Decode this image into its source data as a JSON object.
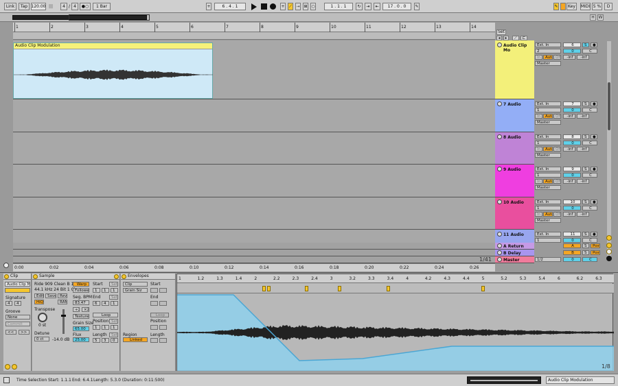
{
  "transport": {
    "link": "Link",
    "tap": "Tap",
    "tempo": "120.00",
    "sig_num": "4",
    "sig_den": "4",
    "metronome": "●○",
    "quantize": "1 Bar",
    "arrangement_pos": "6 . 4 . 1",
    "loop_start": "1 . 1 . 1",
    "loop_length": "17 . 0 . 0",
    "key": "Key",
    "midi": "MIDI",
    "cpu": "5 %",
    "d_label": "D",
    "h_label": "H",
    "w_label": "W"
  },
  "ruler": {
    "bars": [
      "1",
      "2",
      "3",
      "4",
      "5",
      "6",
      "7",
      "8",
      "9",
      "10",
      "11",
      "12",
      "13",
      "14"
    ],
    "set_label": "Set"
  },
  "time_ruler": [
    "0:00",
    "0:02",
    "0:04",
    "0:06",
    "0:08",
    "0:10",
    "0:12",
    "0:14",
    "0:16",
    "0:18",
    "0:20",
    "0:22",
    "0:24",
    "0:26"
  ],
  "page_indicator": "1/41",
  "clip": {
    "name": "Audio Clip Modulation"
  },
  "tracks": [
    {
      "name": "Audio Clip Mo",
      "color": "#f3f07a",
      "num": "6",
      "vol": "0",
      "send": "-inf",
      "send2": "-inf",
      "input": "Ext. In",
      "ch": "2",
      "out": "Master"
    },
    {
      "name": "7 Audio",
      "color": "#93aef6",
      "num": "7",
      "vol": "0",
      "send": "-inf",
      "send2": "-inf",
      "input": "Ext. In",
      "ch": "1",
      "out": "Master"
    },
    {
      "name": "8 Audio",
      "color": "#bf83d6",
      "num": "8",
      "vol": "0",
      "send": "-inf",
      "send2": "-inf",
      "input": "Ext. In",
      "ch": "1",
      "out": "Master"
    },
    {
      "name": "9 Audio",
      "color": "#ef3ee0",
      "num": "9",
      "vol": "0",
      "send": "-inf",
      "send2": "-inf",
      "input": "Ext. In",
      "ch": "1",
      "out": "Master"
    },
    {
      "name": "10 Audio",
      "color": "#e94f9e",
      "num": "10",
      "vol": "0",
      "send": "-inf",
      "send2": "-inf",
      "input": "Ext. In",
      "ch": "1",
      "out": "Master"
    },
    {
      "name": "11 Audio",
      "color": "#98a6ef",
      "num": "11",
      "vol": "0",
      "send": "",
      "send2": "",
      "input": "Ext. In",
      "ch": "1",
      "out": ""
    }
  ],
  "returns": [
    {
      "name": "A Return",
      "color": "#c59ae6",
      "letter": "A",
      "post": "Post"
    },
    {
      "name": "B Delay",
      "color": "#a895ef",
      "letter": "B",
      "post": "Post"
    },
    {
      "name": "Master",
      "color": "#f17b9c",
      "out": "1/2",
      "vol": "0"
    }
  ],
  "io_labels": {
    "in": "In",
    "auto": "Auto",
    "off": "Off",
    "s": "S",
    "c": "C"
  },
  "clip_panel": {
    "title": "Clip",
    "name": "Audio Clip Mo",
    "signature": "Signature",
    "sig_num": "4",
    "sig_den": "4",
    "groove": "Groove",
    "groove_val": "None",
    "commit": "Commit",
    "nav_prev": "<<",
    "nav_next": ">>"
  },
  "sample_panel": {
    "title": "Sample",
    "file": "Ride 909 Clean B 13",
    "info": "44.1 kHz 24 Bit 1 Ch",
    "edit": "Edit",
    "save": "Save",
    "rev": "Rev.",
    "hiq": "HiQ",
    "ram": "RAM",
    "warp": "Warp",
    "follower": "Follower",
    "seg_bpm_label": "Seg. BPM",
    "seg_bpm": "83.47",
    "mode": "Texture",
    "grain_label": "Grain Size",
    "grain": "65.00",
    "flux_label": "Flux",
    "flux": "25.00",
    "transpose_label": "Transpose",
    "transpose": "0 st",
    "detune_label": "Detune",
    "detune": "0 ct",
    "gain": "-14.0 dB",
    "start_label": "Start",
    "set": "Set",
    "start": [
      "1",
      "1",
      "1"
    ],
    "end_label": "End",
    "end": [
      "6",
      "4",
      "1"
    ],
    "loop": "Loop",
    "position_label": "Position",
    "length_label": "Length",
    "length": [
      "5",
      "3",
      "0"
    ],
    "pos_vals": [
      "1",
      "1",
      "1"
    ]
  },
  "env_panel": {
    "title": "Envelopes",
    "device": "Clip",
    "param": "Grain Siz",
    "region_label": "Region",
    "region": "Linked",
    "start_label": "Start",
    "end_label": "End",
    "loop": "Loop",
    "position_label": "Position",
    "length_label": "Length"
  },
  "detail": {
    "bars": [
      "1",
      "1.2",
      "1.3",
      "1.4",
      "2",
      "2.2",
      "2.3",
      "2.4",
      "3",
      "3.2",
      "3.3",
      "3.4",
      "4",
      "4.2",
      "4.3",
      "4.4",
      "5",
      "5.2",
      "5.3",
      "5.4",
      "6",
      "6.2",
      "6.3"
    ],
    "page": "1/8"
  },
  "status": {
    "time_selection": "Time Selection",
    "start": "Start: 1.1.1",
    "end": "End: 6.4.1",
    "length": "Length: 5.3.0 (Duration: 0:11:500)",
    "track_name": "Audio Clip Modulation"
  },
  "colors": {
    "accent": "#f5c62e",
    "clip_bg": "#cfe9f7",
    "envelope": "#7ec8e8"
  }
}
